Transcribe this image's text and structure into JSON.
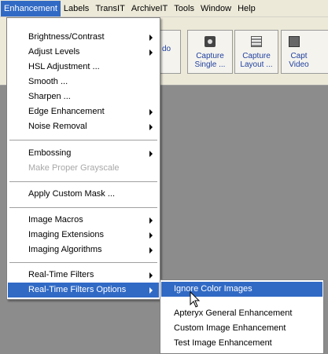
{
  "menubar": [
    "Enhancement",
    "Labels",
    "TransIT",
    "ArchiveIT",
    "Tools",
    "Window",
    "Help"
  ],
  "toolbar": {
    "partial_label": "do",
    "buttons": [
      {
        "label": "Capture Single ...",
        "icon": "camera-icon"
      },
      {
        "label": "Capture Layout ...",
        "icon": "layout-capture-icon"
      },
      {
        "label": "Capt Video",
        "icon": "video-capture-icon"
      }
    ]
  },
  "menu": {
    "items": [
      {
        "label": "Brightness/Contrast",
        "submenu": true
      },
      {
        "label": "Adjust Levels",
        "submenu": true
      },
      {
        "label": "HSL Adjustment ..."
      },
      {
        "label": "Smooth ..."
      },
      {
        "label": "Sharpen ..."
      },
      {
        "label": "Edge Enhancement",
        "submenu": true
      },
      {
        "label": "Noise Removal",
        "submenu": true
      },
      {
        "label": "Embossing",
        "submenu": true
      },
      {
        "label": "Make Proper Grayscale",
        "disabled": true
      },
      {
        "label": "Apply Custom Mask ..."
      },
      {
        "label": "Image Macros",
        "submenu": true
      },
      {
        "label": "Imaging Extensions",
        "submenu": true
      },
      {
        "label": "Imaging Algorithms",
        "submenu": true
      },
      {
        "label": "Real-Time Filters",
        "submenu": true
      },
      {
        "label": "Real-Time Filters Options",
        "submenu": true,
        "highlighted": true
      }
    ]
  },
  "submenu": {
    "items": [
      {
        "label": "Ignore Color Images",
        "highlighted": true
      },
      {
        "label": "Apteryx General Enhancement"
      },
      {
        "label": "Custom Image Enhancement"
      },
      {
        "label": "Test Image Enhancement"
      }
    ]
  },
  "colors": {
    "highlight": "#316ac5",
    "menubar_bg": "#ece9d8",
    "background": "#8c8c8c",
    "disabled_text": "#a8a8a8"
  }
}
